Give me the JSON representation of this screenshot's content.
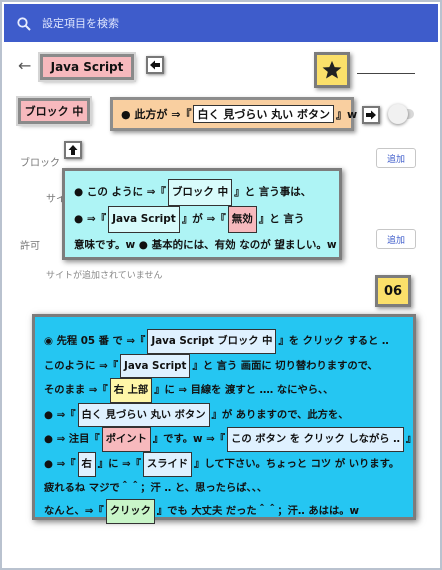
{
  "search": {
    "placeholder": "設定項目を検索"
  },
  "header": {
    "title_label": "Java Script"
  },
  "block_label": "ブロック 中",
  "description_box": {
    "prefix": "● 此方が ⇒『",
    "chip": "白く 見づらい 丸い ボタン",
    "suffix": "』w"
  },
  "sections": {
    "block_label": "ブロック",
    "block_add": "追加",
    "site_label": "サイ",
    "allow_label": "許可",
    "allow_add": "追加",
    "no_sites": "サイトが追加されていません"
  },
  "note_box": {
    "line1": {
      "pre": "● この ように ⇒『",
      "chip": "ブロック 中",
      "post": "』と 言う事は、"
    },
    "line2": {
      "pre": "● ⇒『",
      "chip1": "Java Script",
      "mid": "』が ⇒『",
      "chip2": "無効",
      "post": "』と 言う"
    },
    "line3": "意味です。w ● 基本的には、有効 なのが 望ましい。w"
  },
  "step_number": "06",
  "main_box": {
    "l1": {
      "pre": "◉ 先程 05 番 で ⇒『",
      "chip": "Java Script ブロック 中",
      "post": "』を クリック すると ‥"
    },
    "l2": {
      "pre": "このように ⇒『",
      "chip": "Java Script",
      "post": "』と 言う 画面に 切り替わりますので、"
    },
    "l3": {
      "pre": "そのまま ⇒『",
      "chip": "右 上部",
      "post": "』に ⇒ 目線を 渡すと ‥‥ なにやら、、"
    },
    "l4": {
      "pre": "● ⇒『",
      "chip": "白く 見づらい 丸い ボタン",
      "post": "』が ありますので、此方を、"
    },
    "l5": {
      "pre": "● ⇒ 注目『",
      "chip1": "ポイント",
      "mid": "』です。w ⇒『",
      "chip2": "この ボタン を クリック しながら ‥",
      "post": "』"
    },
    "l6": {
      "pre": "● ⇒『",
      "chip1": "右",
      "mid": "』に ⇒『",
      "chip2": "スライド",
      "post": "』して下さい。ちょっと コツ が いります。"
    },
    "l7": "疲れるね マジで＾＾；汗 ‥ と、思ったらば、、、",
    "l8": {
      "pre": "なんと、⇒『",
      "chip": "クリック",
      "post": "』でも 大丈夫 だった＾＾；汗‥ あはは。w"
    }
  },
  "colors": {
    "search_bar": "#3e5ccb",
    "pink": "#f7b9bd",
    "yellow": "#fbe06a",
    "orange": "#f9cfa0",
    "cyan": "#aef4f5",
    "blue": "#25c6f2"
  },
  "icons": [
    "search-icon",
    "back-arrow-icon",
    "left-arrow-icon",
    "star-icon",
    "right-arrow-icon",
    "up-arrow-icon",
    "toggle-switch"
  ]
}
